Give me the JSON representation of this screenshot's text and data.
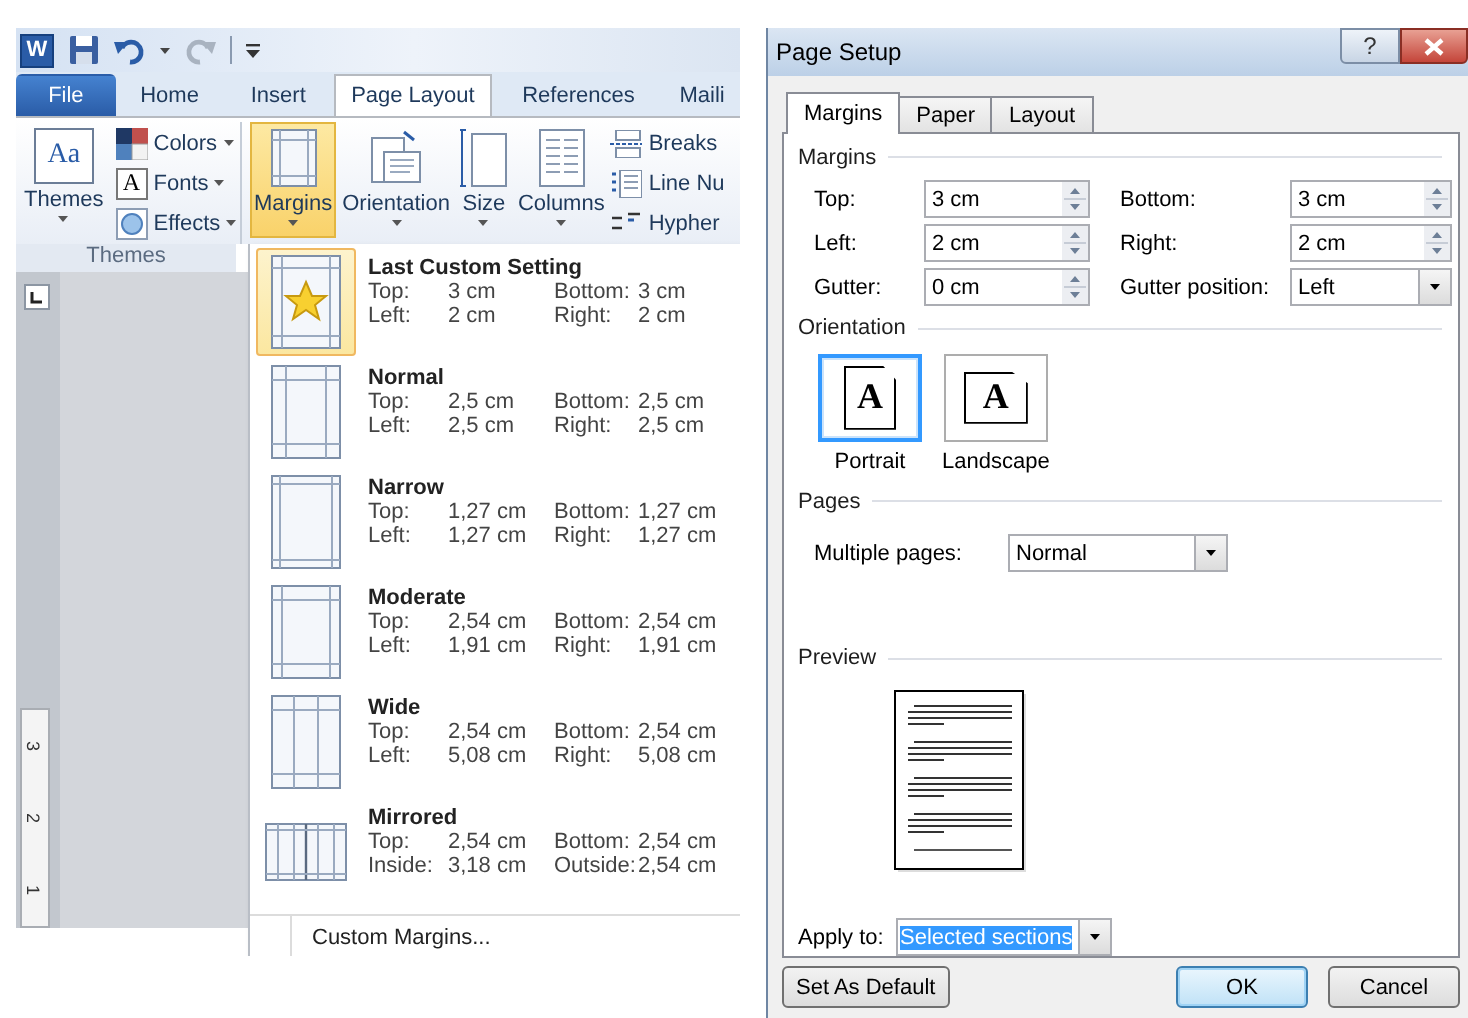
{
  "word": {
    "logo": "W",
    "quick_access": [
      {
        "kind": "save",
        "disabled": false
      },
      {
        "kind": "undo",
        "disabled": false
      },
      {
        "kind": "redo",
        "disabled": true
      },
      {
        "kind": "customize",
        "disabled": false
      }
    ],
    "tabs": [
      {
        "label": "File",
        "kind": "backstage",
        "selected": false
      },
      {
        "label": "Home",
        "kind": "tab",
        "selected": false
      },
      {
        "label": "Insert",
        "kind": "tab",
        "selected": false
      },
      {
        "label": "Page Layout",
        "kind": "tab",
        "selected": true
      },
      {
        "label": "References",
        "kind": "tab",
        "selected": false
      },
      {
        "label": "Maili",
        "kind": "tab",
        "selected": false
      }
    ],
    "themes_group": {
      "label": "Themes",
      "themes_button": {
        "label": "Themes",
        "glyph": "Aa"
      },
      "options": [
        {
          "kind": "colors",
          "label": "Colors"
        },
        {
          "kind": "fonts",
          "label": "Fonts",
          "glyph": "A"
        },
        {
          "kind": "effects",
          "label": "Effects"
        }
      ]
    },
    "page_setup": {
      "buttons": [
        {
          "kind": "margins",
          "label": "Margins",
          "selected": true
        },
        {
          "kind": "orientation",
          "label": "Orientation",
          "selected": false
        },
        {
          "kind": "size",
          "label": "Size",
          "selected": false
        },
        {
          "kind": "columns",
          "label": "Columns",
          "selected": false
        }
      ],
      "options": [
        {
          "kind": "breaks",
          "label": "Breaks"
        },
        {
          "kind": "line_numbers",
          "label": "Line Nu"
        },
        {
          "kind": "hyphenation",
          "label": "Hypher"
        }
      ]
    },
    "ruler": {
      "labels": [
        "3",
        "2",
        "1"
      ]
    },
    "margins_menu": {
      "items": [
        {
          "name": "Last Custom Setting",
          "kind": "custom",
          "selected": true,
          "rows": [
            {
              "label": "Top:",
              "value": "3 cm",
              "label_2": "Bottom:",
              "value_2": "3 cm"
            },
            {
              "label": "Left:",
              "value": "2 cm",
              "label_2": "Right:",
              "value_2": "2 cm"
            }
          ]
        },
        {
          "name": "Normal",
          "kind": "normal",
          "selected": false,
          "rows": [
            {
              "label": "Top:",
              "value": "2,5 cm",
              "label_2": "Bottom:",
              "value_2": "2,5 cm"
            },
            {
              "label": "Left:",
              "value": "2,5 cm",
              "label_2": "Right:",
              "value_2": "2,5 cm"
            }
          ]
        },
        {
          "name": "Narrow",
          "kind": "narrow",
          "selected": false,
          "rows": [
            {
              "label": "Top:",
              "value": "1,27 cm",
              "label_2": "Bottom:",
              "value_2": "1,27 cm"
            },
            {
              "label": "Left:",
              "value": "1,27 cm",
              "label_2": "Right:",
              "value_2": "1,27 cm"
            }
          ]
        },
        {
          "name": "Moderate",
          "kind": "moderate",
          "selected": false,
          "rows": [
            {
              "label": "Top:",
              "value": "2,54 cm",
              "label_2": "Bottom:",
              "value_2": "2,54 cm"
            },
            {
              "label": "Left:",
              "value": "1,91 cm",
              "label_2": "Right:",
              "value_2": "1,91 cm"
            }
          ]
        },
        {
          "name": "Wide",
          "kind": "wide",
          "selected": false,
          "rows": [
            {
              "label": "Top:",
              "value": "2,54 cm",
              "label_2": "Bottom:",
              "value_2": "2,54 cm"
            },
            {
              "label": "Left:",
              "value": "5,08 cm",
              "label_2": "Right:",
              "value_2": "5,08 cm"
            }
          ]
        },
        {
          "name": "Mirrored",
          "kind": "mirrored",
          "selected": false,
          "rows": [
            {
              "label": "Top:",
              "value": "2,54 cm",
              "label_2": "Bottom:",
              "value_2": "2,54 cm"
            },
            {
              "label": "Inside:",
              "value": "3,18 cm",
              "label_2": "Outside:",
              "value_2": "2,54 cm"
            }
          ]
        }
      ],
      "footer": "Custom Margins..."
    }
  },
  "dialog": {
    "title": "Page Setup",
    "help_button": "?",
    "tabs": [
      {
        "label": "Margins",
        "selected": true
      },
      {
        "label": "Paper",
        "selected": false
      },
      {
        "label": "Layout",
        "selected": false
      }
    ],
    "margins": {
      "title": "Margins",
      "fields": [
        {
          "label": "Top:",
          "value": "3 cm",
          "kind": "spin"
        },
        {
          "label": "Bottom:",
          "value": "3 cm",
          "kind": "spin"
        },
        {
          "label": "Left:",
          "value": "2 cm",
          "kind": "spin"
        },
        {
          "label": "Right:",
          "value": "2 cm",
          "kind": "spin"
        },
        {
          "label": "Gutter:",
          "value": "0 cm",
          "kind": "spin"
        },
        {
          "label": "Gutter position:",
          "value": "Left",
          "kind": "select"
        }
      ]
    },
    "orientation": {
      "title": "Orientation",
      "options": [
        {
          "label": "Portrait",
          "kind": "portrait",
          "glyph": "A",
          "selected": true
        },
        {
          "label": "Landscape",
          "kind": "landscape",
          "glyph": "A",
          "selected": false
        }
      ]
    },
    "pages": {
      "title": "Pages",
      "label": "Multiple pages:",
      "value": "Normal"
    },
    "preview": {
      "title": "Preview"
    },
    "apply_to": {
      "label": "Apply to:",
      "value": "Selected sections",
      "text_selected": true
    },
    "buttons": [
      {
        "label": "Set As Default",
        "default": false
      },
      {
        "label": "OK",
        "default": true
      },
      {
        "label": "Cancel",
        "default": false
      }
    ]
  }
}
